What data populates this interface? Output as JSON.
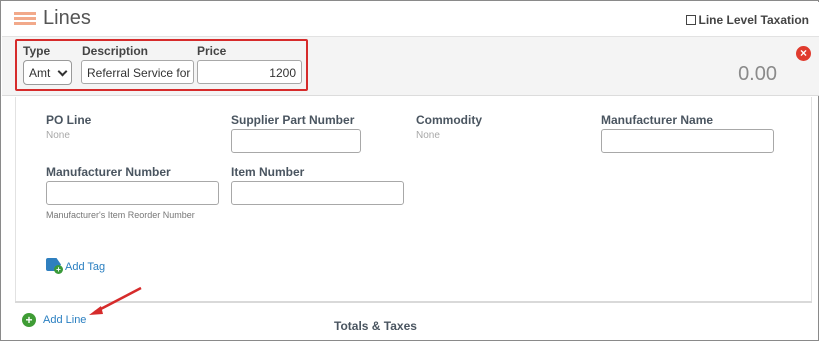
{
  "header": {
    "title": "Lines",
    "line_level_taxation_label": "Line Level Taxation"
  },
  "line": {
    "type_label": "Type",
    "type_value": "Amt",
    "description_label": "Description",
    "description_value": "Referral Service for U",
    "price_label": "Price",
    "price_value": "1200",
    "total": "0.00"
  },
  "details": {
    "po_line_label": "PO Line",
    "po_line_value": "None",
    "supplier_part_number_label": "Supplier Part Number",
    "commodity_label": "Commodity",
    "commodity_value": "None",
    "manufacturer_name_label": "Manufacturer Name",
    "manufacturer_number_label": "Manufacturer Number",
    "manufacturer_number_help": "Manufacturer's Item Reorder Number",
    "item_number_label": "Item Number",
    "add_tag_label": "Add Tag"
  },
  "footer": {
    "add_line_label": "Add Line",
    "totals_label": "Totals & Taxes"
  },
  "colors": {
    "highlight_box": "#d62b2b",
    "link": "#2a7fc1",
    "remove_icon": "#e03b2e",
    "add_icon": "#3f9c35"
  },
  "icons": {
    "section": "lines-icon",
    "remove": "close-icon",
    "tag": "tag-icon",
    "add": "plus-circle-icon"
  }
}
